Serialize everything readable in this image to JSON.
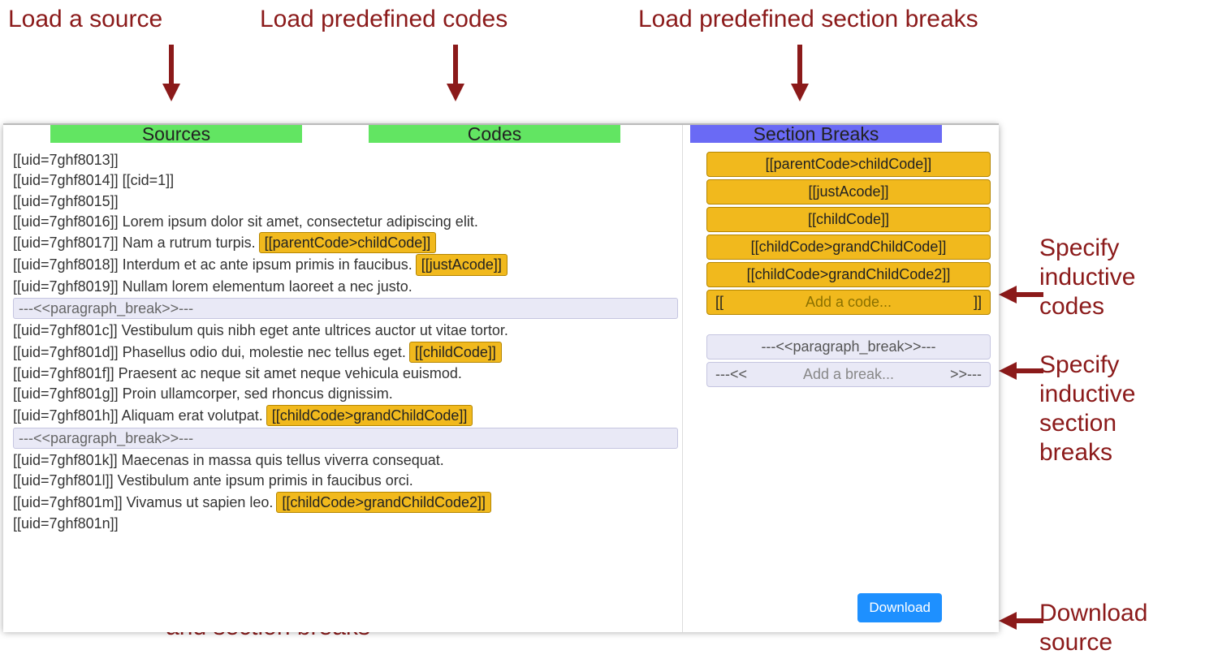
{
  "annotations": {
    "load_source": "Load a source",
    "load_codes": "Load predefined codes",
    "load_breaks": "Load predefined section breaks",
    "specify_codes": "Specify\ninductive\ncodes",
    "specify_breaks": "Specify\ninductive\nsection\nbreaks",
    "loaded_source": "The loaded source\nwith the applied codes\nand section breaks",
    "download": "Download\nsource"
  },
  "tabs": {
    "sources": "Sources",
    "codes": "Codes",
    "breaks": "Section Breaks"
  },
  "source_lines": [
    {
      "uid": "[[uid=7ghf8013]]",
      "text": "",
      "code": null,
      "type": "line"
    },
    {
      "uid": "[[uid=7ghf8014]]",
      "text": "[[cid=1]]",
      "code": null,
      "type": "line"
    },
    {
      "uid": "[[uid=7ghf8015]]",
      "text": "",
      "code": null,
      "type": "line"
    },
    {
      "uid": "[[uid=7ghf8016]]",
      "text": "Lorem ipsum dolor sit amet, consectetur adipiscing elit.",
      "code": null,
      "type": "line"
    },
    {
      "uid": "[[uid=7ghf8017]]",
      "text": "Nam a rutrum turpis.",
      "code": "[[parentCode>childCode]]",
      "type": "line"
    },
    {
      "uid": "[[uid=7ghf8018]]",
      "text": "Interdum et ac ante ipsum primis in faucibus.",
      "code": "[[justAcode]]",
      "type": "line"
    },
    {
      "uid": "[[uid=7ghf8019]]",
      "text": "Nullam lorem elementum laoreet a nec justo.",
      "code": null,
      "type": "line"
    },
    {
      "type": "break",
      "label": "---<<paragraph_break>>---"
    },
    {
      "uid": "[[uid=7ghf801c]]",
      "text": "Vestibulum quis nibh eget ante ultrices auctor ut vitae tortor.",
      "code": null,
      "type": "line"
    },
    {
      "uid": "[[uid=7ghf801d]]",
      "text": "Phasellus odio dui, molestie nec tellus eget.",
      "code": "[[childCode]]",
      "type": "line"
    },
    {
      "uid": "[[uid=7ghf801f]]",
      "text": "Praesent ac neque sit amet neque vehicula euismod.",
      "code": null,
      "type": "line"
    },
    {
      "uid": "[[uid=7ghf801g]]",
      "text": "Proin ullamcorper, sed rhoncus dignissim.",
      "code": null,
      "type": "line"
    },
    {
      "uid": "[[uid=7ghf801h]]",
      "text": "Aliquam erat volutpat.",
      "code": "[[childCode>grandChildCode]]",
      "type": "line"
    },
    {
      "type": "break",
      "label": "---<<paragraph_break>>---"
    },
    {
      "uid": "[[uid=7ghf801k]]",
      "text": "Maecenas in massa quis tellus viverra consequat.",
      "code": null,
      "type": "line"
    },
    {
      "uid": "[[uid=7ghf801l]]",
      "text": "Vestibulum ante ipsum primis in faucibus orci.",
      "code": null,
      "type": "line"
    },
    {
      "uid": "[[uid=7ghf801m]]",
      "text": "Vivamus ut sapien leo.",
      "code": "[[childCode>grandChildCode2]]",
      "type": "line"
    },
    {
      "uid": "[[uid=7ghf801n]]",
      "text": "",
      "code": null,
      "type": "line"
    }
  ],
  "side_codes": [
    "[[parentCode>childCode]]",
    "[[justAcode]]",
    "[[childCode]]",
    "[[childCode>grandChildCode]]",
    "[[childCode>grandChildCode2]]"
  ],
  "add_code": {
    "left": "[[",
    "placeholder": "Add a code...",
    "right": "]]"
  },
  "side_breaks": [
    "---<<paragraph_break>>---"
  ],
  "add_break": {
    "left": "---<<",
    "placeholder": "Add a break...",
    "right": ">>---"
  },
  "download_btn": "Download"
}
